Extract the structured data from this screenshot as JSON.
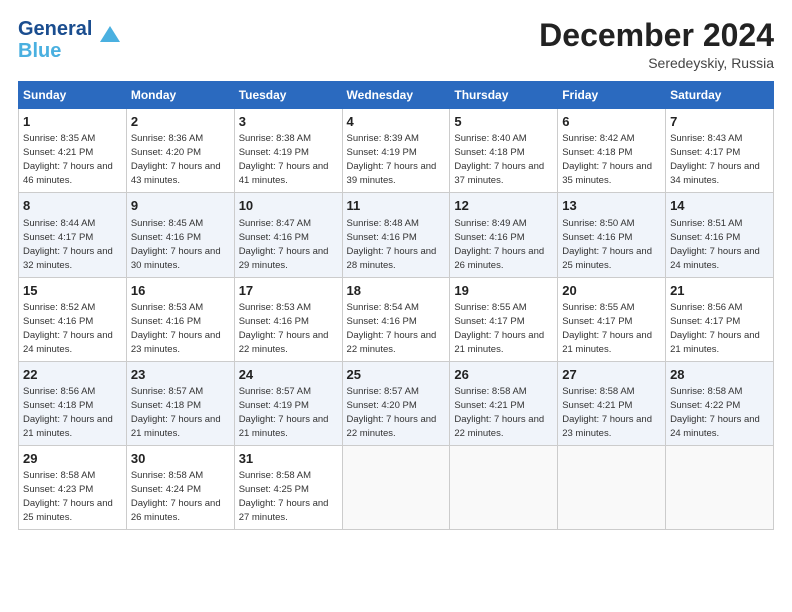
{
  "logo": {
    "line1": "General",
    "line2": "Blue"
  },
  "title": "December 2024",
  "location": "Seredeyskiy, Russia",
  "days_of_week": [
    "Sunday",
    "Monday",
    "Tuesday",
    "Wednesday",
    "Thursday",
    "Friday",
    "Saturday"
  ],
  "weeks": [
    [
      {
        "day": "1",
        "sunrise": "Sunrise: 8:35 AM",
        "sunset": "Sunset: 4:21 PM",
        "daylight": "Daylight: 7 hours and 46 minutes."
      },
      {
        "day": "2",
        "sunrise": "Sunrise: 8:36 AM",
        "sunset": "Sunset: 4:20 PM",
        "daylight": "Daylight: 7 hours and 43 minutes."
      },
      {
        "day": "3",
        "sunrise": "Sunrise: 8:38 AM",
        "sunset": "Sunset: 4:19 PM",
        "daylight": "Daylight: 7 hours and 41 minutes."
      },
      {
        "day": "4",
        "sunrise": "Sunrise: 8:39 AM",
        "sunset": "Sunset: 4:19 PM",
        "daylight": "Daylight: 7 hours and 39 minutes."
      },
      {
        "day": "5",
        "sunrise": "Sunrise: 8:40 AM",
        "sunset": "Sunset: 4:18 PM",
        "daylight": "Daylight: 7 hours and 37 minutes."
      },
      {
        "day": "6",
        "sunrise": "Sunrise: 8:42 AM",
        "sunset": "Sunset: 4:18 PM",
        "daylight": "Daylight: 7 hours and 35 minutes."
      },
      {
        "day": "7",
        "sunrise": "Sunrise: 8:43 AM",
        "sunset": "Sunset: 4:17 PM",
        "daylight": "Daylight: 7 hours and 34 minutes."
      }
    ],
    [
      {
        "day": "8",
        "sunrise": "Sunrise: 8:44 AM",
        "sunset": "Sunset: 4:17 PM",
        "daylight": "Daylight: 7 hours and 32 minutes."
      },
      {
        "day": "9",
        "sunrise": "Sunrise: 8:45 AM",
        "sunset": "Sunset: 4:16 PM",
        "daylight": "Daylight: 7 hours and 30 minutes."
      },
      {
        "day": "10",
        "sunrise": "Sunrise: 8:47 AM",
        "sunset": "Sunset: 4:16 PM",
        "daylight": "Daylight: 7 hours and 29 minutes."
      },
      {
        "day": "11",
        "sunrise": "Sunrise: 8:48 AM",
        "sunset": "Sunset: 4:16 PM",
        "daylight": "Daylight: 7 hours and 28 minutes."
      },
      {
        "day": "12",
        "sunrise": "Sunrise: 8:49 AM",
        "sunset": "Sunset: 4:16 PM",
        "daylight": "Daylight: 7 hours and 26 minutes."
      },
      {
        "day": "13",
        "sunrise": "Sunrise: 8:50 AM",
        "sunset": "Sunset: 4:16 PM",
        "daylight": "Daylight: 7 hours and 25 minutes."
      },
      {
        "day": "14",
        "sunrise": "Sunrise: 8:51 AM",
        "sunset": "Sunset: 4:16 PM",
        "daylight": "Daylight: 7 hours and 24 minutes."
      }
    ],
    [
      {
        "day": "15",
        "sunrise": "Sunrise: 8:52 AM",
        "sunset": "Sunset: 4:16 PM",
        "daylight": "Daylight: 7 hours and 24 minutes."
      },
      {
        "day": "16",
        "sunrise": "Sunrise: 8:53 AM",
        "sunset": "Sunset: 4:16 PM",
        "daylight": "Daylight: 7 hours and 23 minutes."
      },
      {
        "day": "17",
        "sunrise": "Sunrise: 8:53 AM",
        "sunset": "Sunset: 4:16 PM",
        "daylight": "Daylight: 7 hours and 22 minutes."
      },
      {
        "day": "18",
        "sunrise": "Sunrise: 8:54 AM",
        "sunset": "Sunset: 4:16 PM",
        "daylight": "Daylight: 7 hours and 22 minutes."
      },
      {
        "day": "19",
        "sunrise": "Sunrise: 8:55 AM",
        "sunset": "Sunset: 4:17 PM",
        "daylight": "Daylight: 7 hours and 21 minutes."
      },
      {
        "day": "20",
        "sunrise": "Sunrise: 8:55 AM",
        "sunset": "Sunset: 4:17 PM",
        "daylight": "Daylight: 7 hours and 21 minutes."
      },
      {
        "day": "21",
        "sunrise": "Sunrise: 8:56 AM",
        "sunset": "Sunset: 4:17 PM",
        "daylight": "Daylight: 7 hours and 21 minutes."
      }
    ],
    [
      {
        "day": "22",
        "sunrise": "Sunrise: 8:56 AM",
        "sunset": "Sunset: 4:18 PM",
        "daylight": "Daylight: 7 hours and 21 minutes."
      },
      {
        "day": "23",
        "sunrise": "Sunrise: 8:57 AM",
        "sunset": "Sunset: 4:18 PM",
        "daylight": "Daylight: 7 hours and 21 minutes."
      },
      {
        "day": "24",
        "sunrise": "Sunrise: 8:57 AM",
        "sunset": "Sunset: 4:19 PM",
        "daylight": "Daylight: 7 hours and 21 minutes."
      },
      {
        "day": "25",
        "sunrise": "Sunrise: 8:57 AM",
        "sunset": "Sunset: 4:20 PM",
        "daylight": "Daylight: 7 hours and 22 minutes."
      },
      {
        "day": "26",
        "sunrise": "Sunrise: 8:58 AM",
        "sunset": "Sunset: 4:21 PM",
        "daylight": "Daylight: 7 hours and 22 minutes."
      },
      {
        "day": "27",
        "sunrise": "Sunrise: 8:58 AM",
        "sunset": "Sunset: 4:21 PM",
        "daylight": "Daylight: 7 hours and 23 minutes."
      },
      {
        "day": "28",
        "sunrise": "Sunrise: 8:58 AM",
        "sunset": "Sunset: 4:22 PM",
        "daylight": "Daylight: 7 hours and 24 minutes."
      }
    ],
    [
      {
        "day": "29",
        "sunrise": "Sunrise: 8:58 AM",
        "sunset": "Sunset: 4:23 PM",
        "daylight": "Daylight: 7 hours and 25 minutes."
      },
      {
        "day": "30",
        "sunrise": "Sunrise: 8:58 AM",
        "sunset": "Sunset: 4:24 PM",
        "daylight": "Daylight: 7 hours and 26 minutes."
      },
      {
        "day": "31",
        "sunrise": "Sunrise: 8:58 AM",
        "sunset": "Sunset: 4:25 PM",
        "daylight": "Daylight: 7 hours and 27 minutes."
      },
      null,
      null,
      null,
      null
    ]
  ]
}
